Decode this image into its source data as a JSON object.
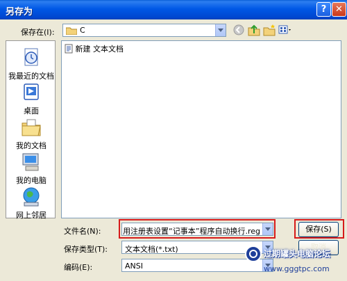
{
  "window": {
    "title": "另存为",
    "help_label": "?",
    "close_label": "✕"
  },
  "location": {
    "label": "保存在(I):",
    "folder_name": "C"
  },
  "toolbar": {
    "back_icon": "back-icon",
    "up_icon": "up-folder-icon",
    "new_folder_icon": "new-folder-icon",
    "views_icon": "views-menu-icon"
  },
  "places": [
    {
      "label": "我最近的文档",
      "icon": "recent-documents-icon"
    },
    {
      "label": "桌面",
      "icon": "desktop-icon"
    },
    {
      "label": "我的文档",
      "icon": "my-documents-icon"
    },
    {
      "label": "我的电脑",
      "icon": "my-computer-icon"
    },
    {
      "label": "网上邻居",
      "icon": "network-places-icon"
    }
  ],
  "files": [
    {
      "name": "新建 文本文档",
      "icon": "text-file-icon"
    }
  ],
  "form": {
    "filename_label": "文件名(N):",
    "filename_value": "用注册表设置“记事本”程序自动换行.reg",
    "filetype_label": "保存类型(T):",
    "filetype_value": "文本文档(*.txt)",
    "encoding_label": "编码(E):",
    "encoding_value": "ANSI"
  },
  "buttons": {
    "save": "保存(S)",
    "cancel": "取消"
  },
  "watermark": {
    "text": "过期罐头电脑论坛",
    "url": "www.gggtpc.com"
  },
  "colors": {
    "titlebar": "#0058e6",
    "dialog_bg": "#ece9d8",
    "highlight": "#d61a1a"
  }
}
